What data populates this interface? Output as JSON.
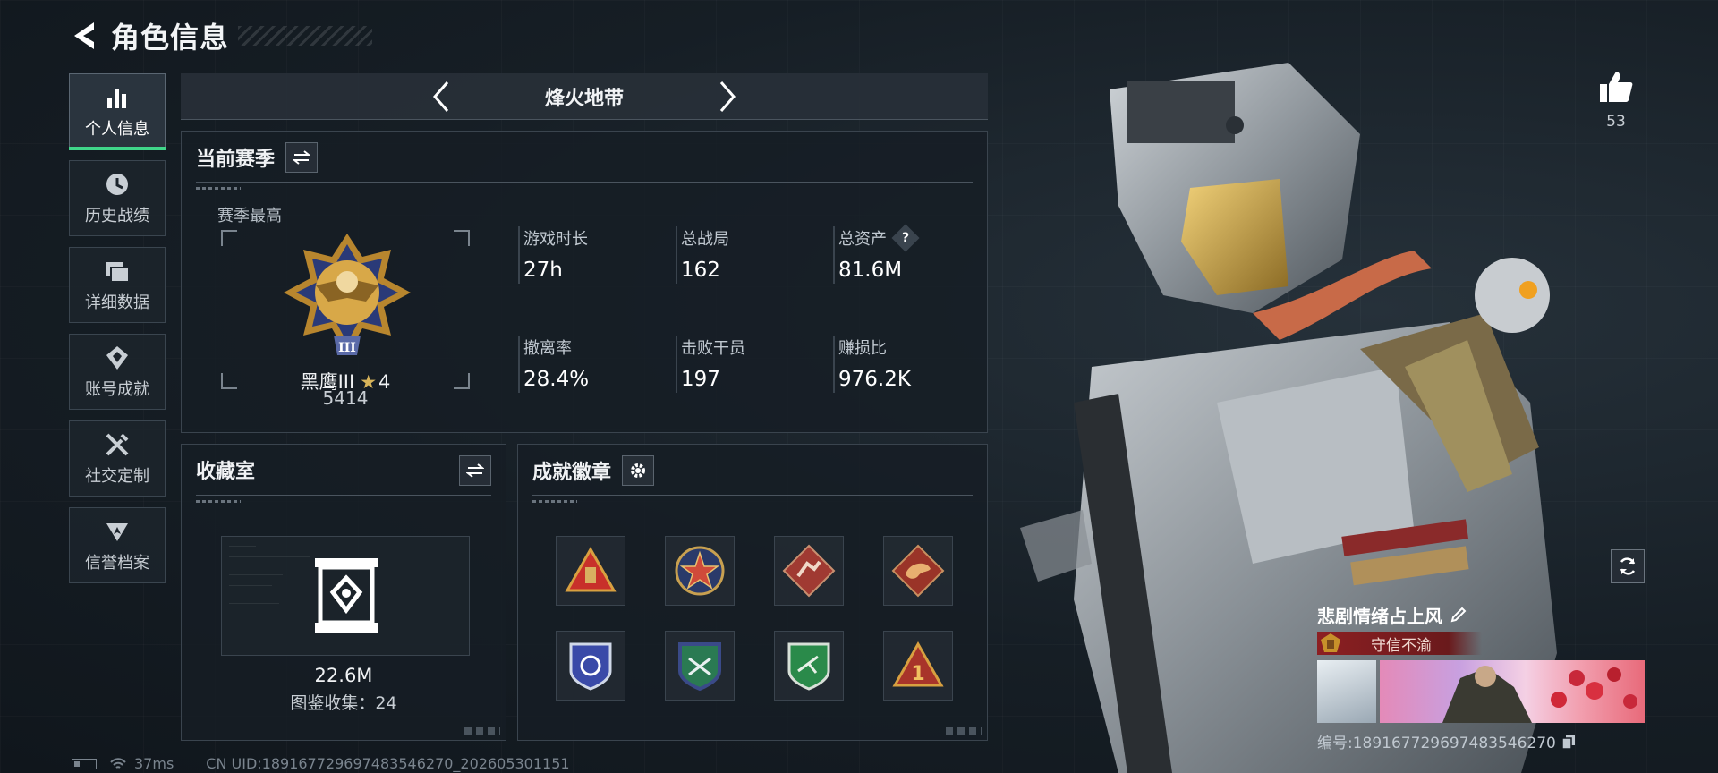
{
  "header": {
    "title": "角色信息"
  },
  "sidebar": {
    "items": [
      {
        "label": "个人信息",
        "icon": "bar-chart-icon",
        "active": true
      },
      {
        "label": "历史战绩",
        "icon": "history-icon",
        "active": false
      },
      {
        "label": "详细数据",
        "icon": "folder-icon",
        "active": false
      },
      {
        "label": "账号成就",
        "icon": "achievement-icon",
        "active": false
      },
      {
        "label": "社交定制",
        "icon": "tools-icon",
        "active": false
      },
      {
        "label": "信誉档案",
        "icon": "reputation-icon",
        "active": false
      }
    ]
  },
  "mode": {
    "name": "烽火地带"
  },
  "season": {
    "title": "当前赛季",
    "subtitle": "赛季最高",
    "rank_name": "黑鹰III",
    "rank_stars": "4",
    "rank_score": "5414",
    "stats": [
      {
        "label": "游戏时长",
        "value": "27h"
      },
      {
        "label": "总战局",
        "value": "162"
      },
      {
        "label": "总资产",
        "value": "81.6M",
        "help": true
      },
      {
        "label": "撤离率",
        "value": "28.4%"
      },
      {
        "label": "击败干员",
        "value": "197"
      },
      {
        "label": "赚损比",
        "value": "976.2K"
      }
    ]
  },
  "collection": {
    "title": "收藏室",
    "value": "22.6M",
    "count_text": "图鉴收集：24"
  },
  "badges": {
    "title": "成就徽章",
    "items": [
      {
        "name": "triangle-badge",
        "color": "#c8302a"
      },
      {
        "name": "star-badge",
        "color": "#d04a3a"
      },
      {
        "name": "runner-badge",
        "color": "#a03a32"
      },
      {
        "name": "dragon-badge",
        "color": "#9a3428"
      },
      {
        "name": "blue-shield-badge",
        "color": "#3a4aa8"
      },
      {
        "name": "green-shield-badge-1",
        "color": "#2a7a52"
      },
      {
        "name": "green-shield-badge-2",
        "color": "#2a8a4a"
      },
      {
        "name": "rank-1-badge",
        "color": "#a8342a"
      }
    ]
  },
  "footer": {
    "ping": "37ms",
    "uid": "CN UID:189167729697483546270_202605301151"
  },
  "profile": {
    "likes": "53",
    "name": "悲剧情绪占上风",
    "title": "守信不渝",
    "id_text": "编号:189167729697483546270"
  },
  "colors": {
    "accent": "#40d68a",
    "title_bg": "#8c1f22"
  }
}
